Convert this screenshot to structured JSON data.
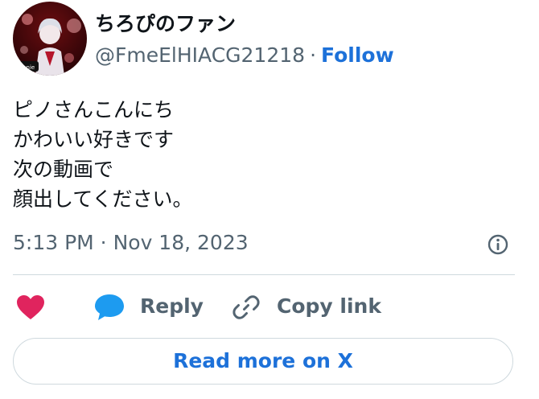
{
  "author": {
    "display_name": "ちろぴのファン",
    "handle": "@FmeElHIACG21218",
    "separator": "·",
    "follow_label": "Follow",
    "avatar_badge": "Genie"
  },
  "tweet": {
    "lines": [
      "ピノさんこんにち",
      "かわいい好きです",
      "次の動画で",
      "顔出してください。"
    ],
    "timestamp": "5:13 PM · Nov 18, 2023"
  },
  "actions": {
    "reply_label": "Reply",
    "copy_link_label": "Copy link"
  },
  "read_more_label": "Read more on X",
  "icons": {
    "like": "heart-icon",
    "reply": "speech-bubble-icon",
    "copy": "link-icon",
    "info": "info-icon"
  },
  "colors": {
    "accent": "#1d71d9",
    "heart": "#e0245e",
    "reply_icon": "#1d9bf0",
    "muted": "#536471",
    "divider": "#cfd9de"
  }
}
